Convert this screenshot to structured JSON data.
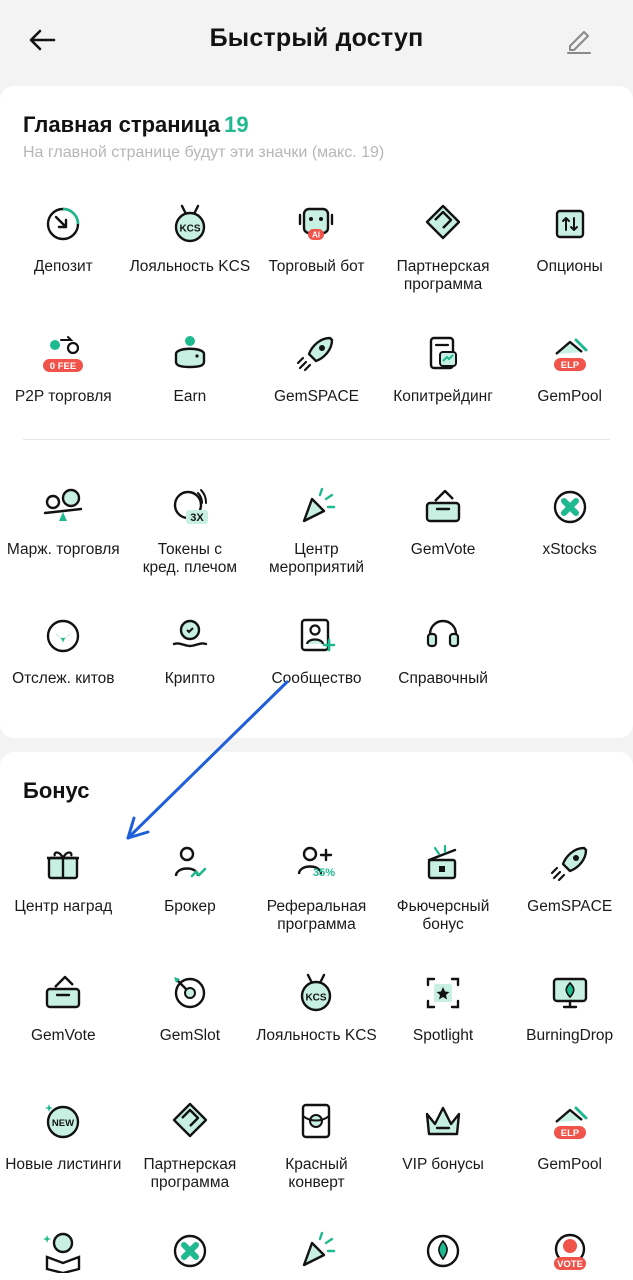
{
  "header": {
    "title": "Быстрый доступ"
  },
  "main": {
    "title": "Главная страница",
    "count": "19",
    "subtitle": "На главной странице будут эти значки (макс. 19)",
    "rows": [
      [
        {
          "label": "Депозит",
          "icon": "deposit-icon"
        },
        {
          "label": "Лояльность KCS",
          "icon": "kcs-loyalty-icon"
        },
        {
          "label": "Торговый бот",
          "icon": "trading-bot-icon"
        },
        {
          "label": "Партнерская\nпрограмма",
          "icon": "partner-handshake-icon"
        },
        {
          "label": "Опционы",
          "icon": "options-icon"
        }
      ],
      [
        {
          "label": "P2P торговля",
          "icon": "p2p-icon"
        },
        {
          "label": "Earn",
          "icon": "earn-piggy-icon"
        },
        {
          "label": "GemSPACE",
          "icon": "gemspace-rocket-icon"
        },
        {
          "label": "Копитрейдинг",
          "icon": "copytrading-icon"
        },
        {
          "label": "GemPool",
          "icon": "gempool-icon"
        }
      ],
      [
        {
          "label": "Марж. торговля",
          "icon": "margin-icon"
        },
        {
          "label": "Токены с\nкред. плечом",
          "icon": "leveraged-tokens-icon"
        },
        {
          "label": "Центр\nмероприятий",
          "icon": "events-party-icon"
        },
        {
          "label": "GemVote",
          "icon": "gemvote-icon"
        },
        {
          "label": "xStocks",
          "icon": "xstocks-icon"
        }
      ],
      [
        {
          "label": "Отслеж. китов",
          "icon": "whale-icon"
        },
        {
          "label": "Крипто",
          "icon": "crypto-hand-icon"
        },
        {
          "label": "Сообщество",
          "icon": "community-icon"
        },
        {
          "label": "Справочный",
          "icon": "support-headset-icon"
        }
      ]
    ],
    "badges": {
      "fee": "0 FEE",
      "elp": "ELP",
      "ai": "AI",
      "kcs": "KCS",
      "lev": "3X"
    }
  },
  "bonus": {
    "title": "Бонус",
    "rows": [
      [
        {
          "label": "Центр наград",
          "icon": "gift-icon"
        },
        {
          "label": "Брокер",
          "icon": "broker-icon"
        },
        {
          "label": "Реферальная\nпрограмма",
          "icon": "referral-icon"
        },
        {
          "label": "Фьючерсный\nбонус",
          "icon": "futures-bonus-icon"
        },
        {
          "label": "GemSPACE",
          "icon": "gemspace-rocket-icon"
        }
      ],
      [
        {
          "label": "GemVote",
          "icon": "gemvote-icon"
        },
        {
          "label": "GemSlot",
          "icon": "gemslot-icon"
        },
        {
          "label": "Лояльность KCS",
          "icon": "kcs-loyalty-icon"
        },
        {
          "label": "Spotlight",
          "icon": "spotlight-icon"
        },
        {
          "label": "BurningDrop",
          "icon": "burningdrop-icon"
        }
      ],
      [
        {
          "label": "Новые листинги",
          "icon": "new-listing-icon"
        },
        {
          "label": "Партнерская\nпрограмма",
          "icon": "partner-handshake-icon"
        },
        {
          "label": "Красный\nконверт",
          "icon": "red-envelope-icon"
        },
        {
          "label": "VIP бонусы",
          "icon": "vip-crown-icon"
        },
        {
          "label": "GemPool",
          "icon": "gempool-icon"
        }
      ],
      [
        {
          "label": "",
          "icon": "learn-book-icon"
        },
        {
          "label": "",
          "icon": "xstocks-icon"
        },
        {
          "label": "",
          "icon": "events-party-icon"
        },
        {
          "label": "",
          "icon": "drop-icon"
        },
        {
          "label": "",
          "icon": "vote-btc-icon"
        }
      ]
    ],
    "badges": {
      "referral": "35%",
      "new": "NEW",
      "vote": "VOTE"
    }
  },
  "colors": {
    "accent": "#1fb98f",
    "red": "#f0534a",
    "ink": "#121212"
  }
}
